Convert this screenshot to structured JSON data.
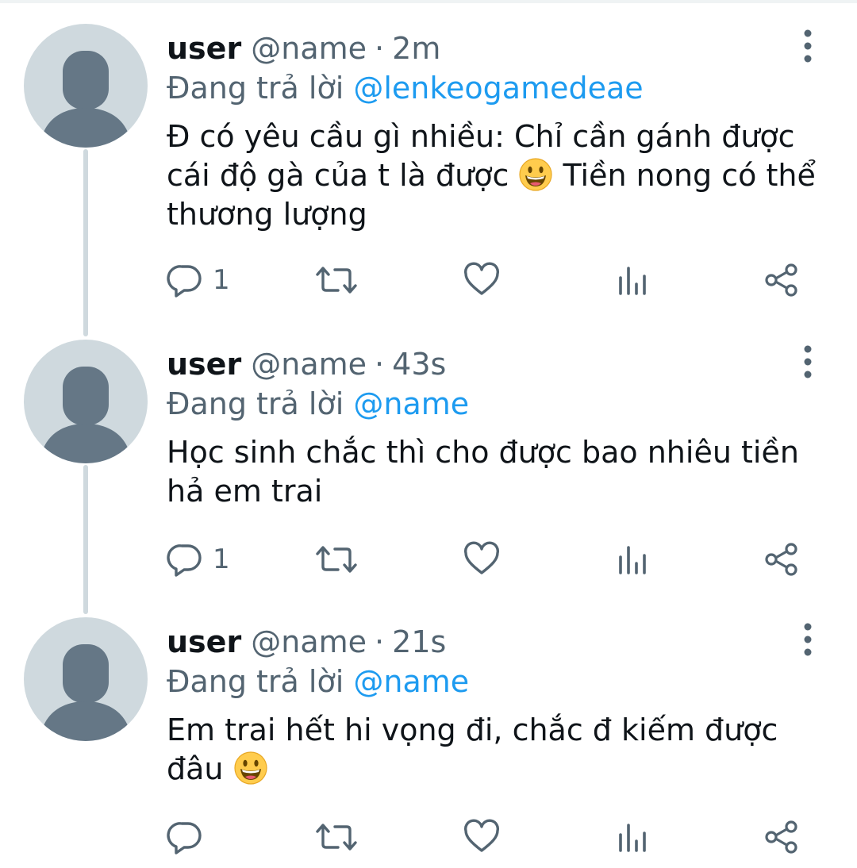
{
  "tweets": [
    {
      "display_name": "user",
      "handle": "@name",
      "time": "2m",
      "replying_label": "Đang trả lời",
      "replying_to": "@lenkeogamedeae",
      "text_before_emoji": "Đ có yêu cầu gì nhiều: Chỉ cần gánh được cái độ gà của t là được ",
      "text_after_emoji": " Tiền nong có thể thương lượng",
      "emoji": "grinning-face",
      "reply_count": "1"
    },
    {
      "display_name": "user",
      "handle": "@name",
      "time": "43s",
      "replying_label": "Đang trả lời",
      "replying_to": "@name",
      "text_before_emoji": "Học sinh chắc thì cho được bao nhiêu tiền hả em trai",
      "text_after_emoji": "",
      "emoji": "",
      "reply_count": "1"
    },
    {
      "display_name": "user",
      "handle": "@name",
      "time": "21s",
      "replying_label": "Đang trả lời",
      "replying_to": "@name",
      "text_before_emoji": "Em trai hết hi vọng đi, chắc đ kiếm được đâu ",
      "text_after_emoji": "",
      "emoji": "grinning-face",
      "reply_count": ""
    }
  ],
  "separator": "·",
  "icons": [
    "reply-icon",
    "retweet-icon",
    "like-icon",
    "analytics-icon",
    "share-icon",
    "more-icon",
    "default-avatar"
  ],
  "colors": {
    "text": "#0f1419",
    "secondary": "#536471",
    "accent": "#1d9bf0",
    "avatar_bg": "#cfd9de",
    "avatar_fg": "#657786"
  }
}
